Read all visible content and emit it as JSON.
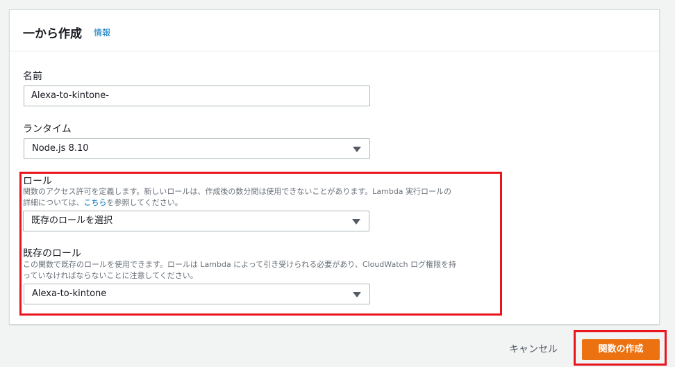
{
  "panel": {
    "title": "一から作成",
    "info_link": "情報"
  },
  "fields": {
    "name": {
      "label": "名前",
      "value": "Alexa-to-kintone-"
    },
    "runtime": {
      "label": "ランタイム",
      "value": "Node.js 8.10"
    },
    "role": {
      "label": "ロール",
      "desc_line1": "関数のアクセス許可を定義します。新しいロールは、作成後の数分間は使用できないことがあります。Lambda 実行ロールの",
      "desc_line2_pre": "詳細については、",
      "desc_link": "こちら",
      "desc_line2_post": "を参照してください。",
      "value": "既存のロールを選択"
    },
    "existing_role": {
      "label": "既存のロール",
      "desc_line1": "この関数で既存のロールを使用できます。ロールは Lambda によって引き受けられる必要があり、CloudWatch ログ権限を持",
      "desc_line2": "っていなければならないことに注意してください。",
      "value": "Alexa-to-kintone"
    }
  },
  "footer": {
    "cancel_label": "キャンセル",
    "create_label": "関数の作成"
  },
  "colors": {
    "highlight": "#e8141e",
    "primary": "#ec7211",
    "link": "#0073bb"
  }
}
